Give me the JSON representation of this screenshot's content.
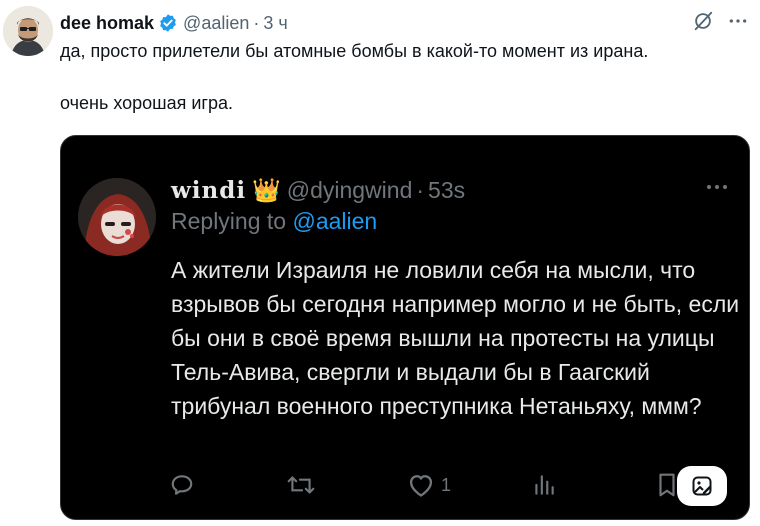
{
  "outer_tweet": {
    "author_name": "dee homak",
    "handle": "@aalien",
    "separator": "·",
    "time": "3 ч",
    "paragraphs": [
      "да, просто прилетели бы атомные бомбы в какой-то момент из ирана.",
      "очень хорошая игра."
    ],
    "icons": {
      "verified": "verified-badge-icon",
      "grok": "grok-icon",
      "more": "more-icon"
    }
  },
  "quoted_tweet": {
    "author_name": "windi",
    "author_emoji": "👑",
    "handle": "@dyingwind",
    "separator": "·",
    "time": "53s",
    "replying_to_label": "Replying to",
    "replying_to_handle": "@aalien",
    "text": "А жители Израиля не ловили себя на мысли, что взрывов бы сегодня например могло и не быть, если бы они в своё время вышли на протесты на улицы Тель-Авива, свергли и выдали бы в Гаагский трибунал военного преступника Нетаньяху, ммм?",
    "actions": {
      "like_count": "1"
    }
  },
  "colors": {
    "text_dark": "#0f1419",
    "secondary": "#536471",
    "card_bg": "#000000",
    "card_text": "#e7e9ea",
    "card_secondary": "#71767b",
    "link": "#1d9bf0",
    "verified": "#1d9bf0"
  }
}
